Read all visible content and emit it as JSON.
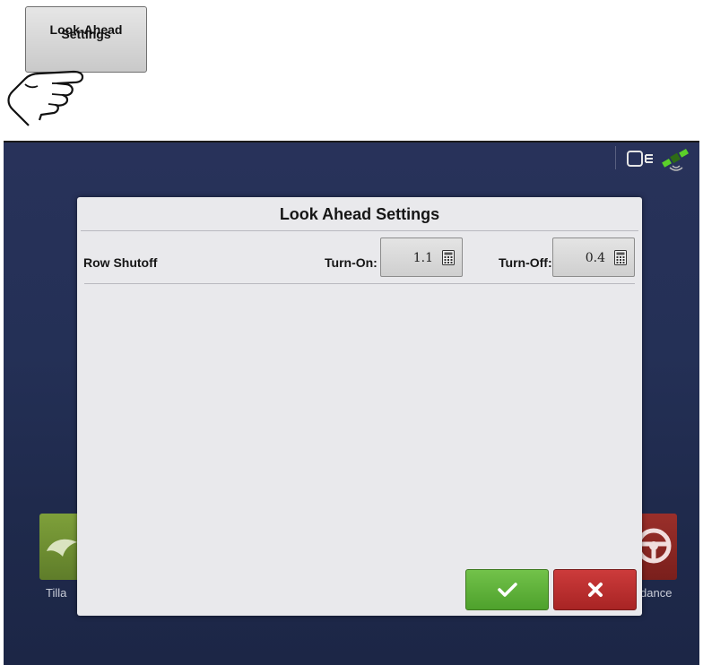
{
  "callout": {
    "button_line1": "Look-Ahead",
    "button_line2": "Settings",
    "pointer_icon": "hand-pointer-icon"
  },
  "status_bar": {
    "implement_icon": "implement-display-icon",
    "gps_icon": "gps-satellite-icon"
  },
  "background_tiles": {
    "left_label": "Tilla",
    "right_label": "dance"
  },
  "dialog": {
    "title": "Look Ahead Settings",
    "row_label": "Row Shutoff",
    "turn_on_label": "Turn-On:",
    "turn_on_value": "1.1",
    "turn_off_label": "Turn-Off:",
    "turn_off_value": "0.4",
    "calculator_icon": "calculator-icon",
    "accept_icon": "checkmark-icon",
    "cancel_icon": "x-icon"
  },
  "colors": {
    "screen_bg": "#243056",
    "dialog_bg": "#e9e9ec",
    "accept_green": "#5cb336",
    "cancel_red": "#b82e2e"
  }
}
